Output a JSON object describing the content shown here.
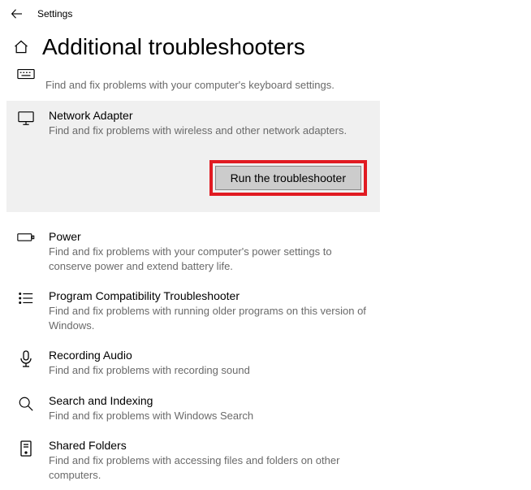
{
  "topbar": {
    "title": "Settings"
  },
  "page": {
    "title": "Additional troubleshooters"
  },
  "items": {
    "keyboard": {
      "desc": "Find and fix problems with your computer's keyboard settings."
    },
    "network": {
      "title": "Network Adapter",
      "desc": "Find and fix problems with wireless and other network adapters.",
      "button": "Run the troubleshooter"
    },
    "power": {
      "title": "Power",
      "desc": "Find and fix problems with your computer's power settings to conserve power and extend battery life."
    },
    "compat": {
      "title": "Program Compatibility Troubleshooter",
      "desc": "Find and fix problems with running older programs on this version of Windows."
    },
    "audio": {
      "title": "Recording Audio",
      "desc": "Find and fix problems with recording sound"
    },
    "search": {
      "title": "Search and Indexing",
      "desc": "Find and fix problems with Windows Search"
    },
    "folders": {
      "title": "Shared Folders",
      "desc": "Find and fix problems with accessing files and folders on other computers."
    }
  }
}
